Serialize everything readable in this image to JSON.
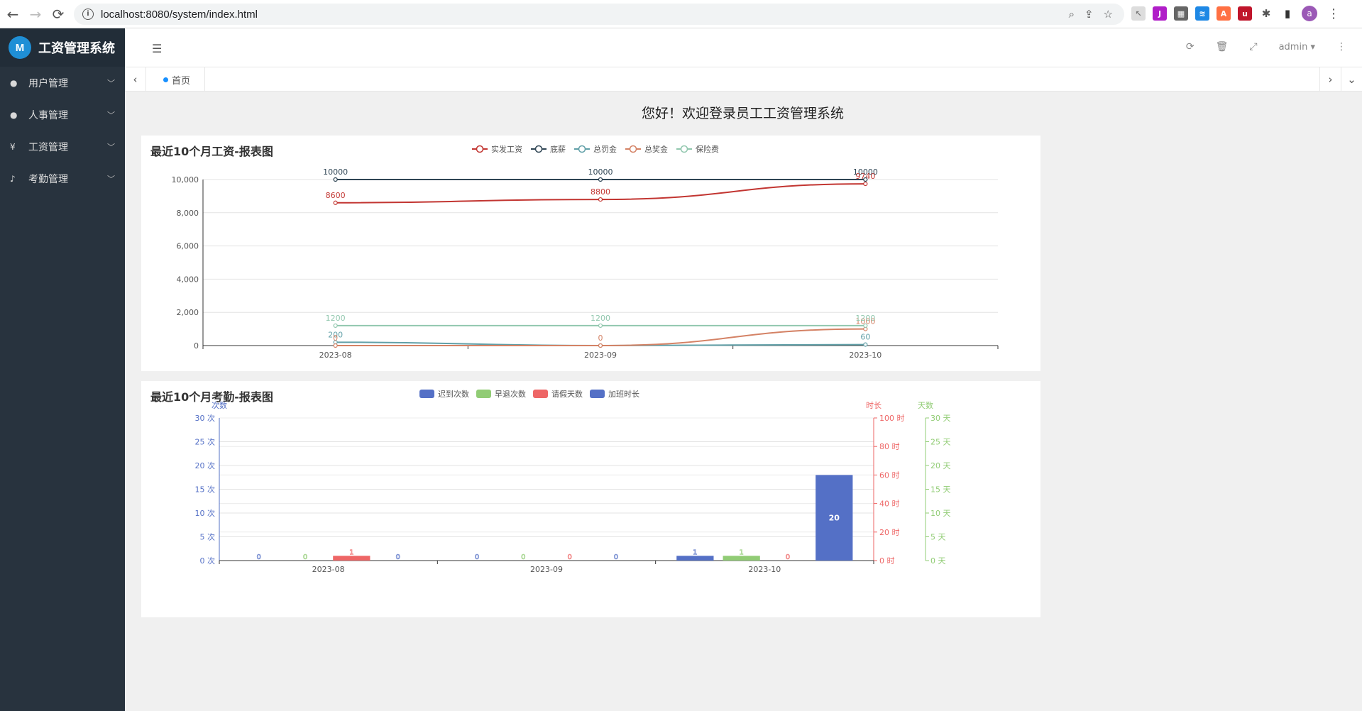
{
  "browser": {
    "back": "←",
    "forward": "→",
    "reload": "⟳",
    "url": "localhost:8080/system/index.html",
    "avatar_letter": "a"
  },
  "sidebar": {
    "brand": "工资管理系统",
    "logo_text": "M",
    "items": [
      {
        "icon": "user-icon",
        "glyph": "👤",
        "label": "用户管理"
      },
      {
        "icon": "people-icon",
        "glyph": "👥",
        "label": "人事管理"
      },
      {
        "icon": "yen-icon",
        "glyph": "¥",
        "label": "工资管理"
      },
      {
        "icon": "bell-icon",
        "glyph": "🔔",
        "label": "考勤管理"
      }
    ]
  },
  "header": {
    "user": "admin"
  },
  "tabs": {
    "home": "首页"
  },
  "main": {
    "welcome": "您好！欢迎登录员工工资管理系统"
  },
  "colors": {
    "sidebar_bg": "#28333e",
    "accent": "#1890ff",
    "series_salary": "#c23531",
    "series_base": "#2f4554",
    "series_fine": "#61a0a8",
    "series_bonus": "#d48265",
    "series_insurance": "#91c7ae",
    "bar_blue": "#5470c6",
    "bar_green": "#91cc75",
    "bar_red": "#ee6666"
  },
  "chart_data": [
    {
      "type": "line",
      "title": "最近10个月工资-报表图",
      "categories": [
        "2023-08",
        "2023-09",
        "2023-10"
      ],
      "ylim": [
        0,
        10000
      ],
      "yticks": [
        "0",
        "2,000",
        "4,000",
        "6,000",
        "8,000",
        "10,000"
      ],
      "legend_position": "top-center",
      "grid": true,
      "series": [
        {
          "name": "实发工资",
          "values": [
            8600,
            8800,
            9740
          ],
          "labels": [
            "8600",
            "8800",
            "9740"
          ],
          "color": "#c23531"
        },
        {
          "name": "底薪",
          "values": [
            10000,
            10000,
            10000
          ],
          "labels": [
            "10000",
            "10000",
            "10000"
          ],
          "color": "#2f4554"
        },
        {
          "name": "总罚金",
          "values": [
            200,
            0,
            60
          ],
          "labels": [
            "200",
            "",
            "60"
          ],
          "color": "#61a0a8"
        },
        {
          "name": "总奖金",
          "values": [
            0,
            0,
            1000
          ],
          "labels": [
            "0",
            "0",
            "1000"
          ],
          "color": "#d48265"
        },
        {
          "name": "保险费",
          "values": [
            1200,
            1200,
            1200
          ],
          "labels": [
            "1200",
            "1200",
            "1200"
          ],
          "color": "#91c7ae"
        }
      ]
    },
    {
      "type": "bar",
      "title": "最近10个月考勤-报表图",
      "categories": [
        "2023-08",
        "2023-09",
        "2023-10"
      ],
      "legend_position": "top-center",
      "grid": true,
      "axes": [
        {
          "name": "次数",
          "ylim": [
            0,
            30
          ],
          "ticks": [
            "0 次",
            "5 次",
            "10 次",
            "15 次",
            "20 次",
            "25 次",
            "30 次"
          ],
          "color": "#5470c6"
        },
        {
          "name": "时长",
          "ylim": [
            0,
            100
          ],
          "ticks": [
            "0 时",
            "20 时",
            "40 时",
            "60 时",
            "80 时",
            "100 时"
          ],
          "color": "#ee6666"
        },
        {
          "name": "天数",
          "ylim": [
            0,
            30
          ],
          "ticks": [
            "0 天",
            "5 天",
            "10 天",
            "15 天",
            "20 天",
            "25 天",
            "30 天"
          ],
          "color": "#91cc75"
        }
      ],
      "series": [
        {
          "name": "迟到次数",
          "axis": 0,
          "values": [
            0,
            0,
            1
          ],
          "labels": [
            "0",
            "0",
            "1"
          ],
          "color": "#5470c6"
        },
        {
          "name": "早退次数",
          "axis": 0,
          "values": [
            0,
            0,
            1
          ],
          "labels": [
            "0",
            "0",
            "1"
          ],
          "color": "#91cc75"
        },
        {
          "name": "请假天数",
          "axis": 2,
          "values": [
            1,
            0,
            0
          ],
          "labels": [
            "1",
            "0",
            "0"
          ],
          "color": "#ee6666"
        },
        {
          "name": "加班时长",
          "axis": 1,
          "values": [
            0,
            0,
            60
          ],
          "labels": [
            "0",
            "0",
            "20"
          ],
          "color": "#5470c6"
        }
      ]
    }
  ]
}
